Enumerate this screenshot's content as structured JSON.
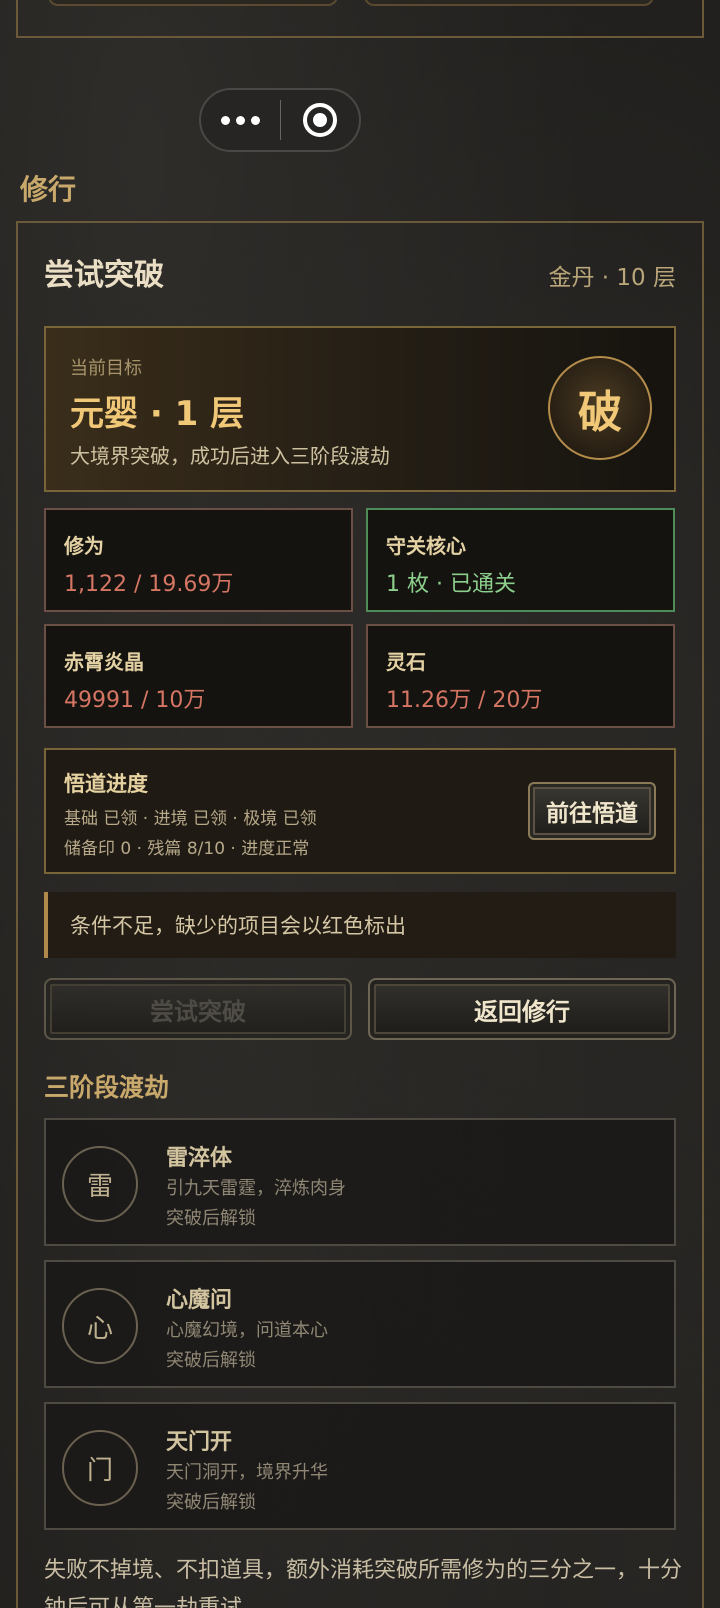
{
  "colors": {
    "accent_gold": "#c9a96b",
    "missing_red": "#d57563",
    "ok_green": "#8ccf8c"
  },
  "capsule": {
    "more_icon": "more-dots-icon",
    "close_icon": "target-circle-icon"
  },
  "section_title": "修行",
  "card": {
    "title": "尝试突破",
    "realm": "金丹 · 10 层"
  },
  "target": {
    "label": "当前目标",
    "value": "元婴 · 1 层",
    "desc": "大境界突破，成功后进入三阶段渡劫",
    "break_button": "破"
  },
  "stats": [
    {
      "name": "修为",
      "value": "1,122 / 19.69万",
      "status": "missing"
    },
    {
      "name": "守关核心",
      "value": "1 枚 · 已通关",
      "status": "ok"
    },
    {
      "name": "赤霄炎晶",
      "value": "49991 / 10万",
      "status": "missing"
    },
    {
      "name": "灵石",
      "value": "11.26万 / 20万",
      "status": "missing"
    }
  ],
  "wudao": {
    "title": "悟道进度",
    "line1": "基础 已领 · 进境 已领 · 极境 已领",
    "line2": "储备印 0 · 残篇 8/10 · 进度正常",
    "button": "前往悟道"
  },
  "notice": "条件不足，缺少的项目会以红色标出",
  "actions": {
    "attempt": "尝试突破",
    "back": "返回修行"
  },
  "trials_title": "三阶段渡劫",
  "trials": [
    {
      "glyph": "雷",
      "name": "雷淬体",
      "desc": "引九天雷霆，淬炼肉身",
      "lock": "突破后解锁"
    },
    {
      "glyph": "心",
      "name": "心魔问",
      "desc": "心魔幻境，问道本心",
      "lock": "突破后解锁"
    },
    {
      "glyph": "门",
      "name": "天门开",
      "desc": "天门洞开，境界升华",
      "lock": "突破后解锁"
    }
  ],
  "footnote": "失败不掉境、不扣道具，额外消耗突破所需修为的三分之一，十分钟后可从第一劫重试。"
}
